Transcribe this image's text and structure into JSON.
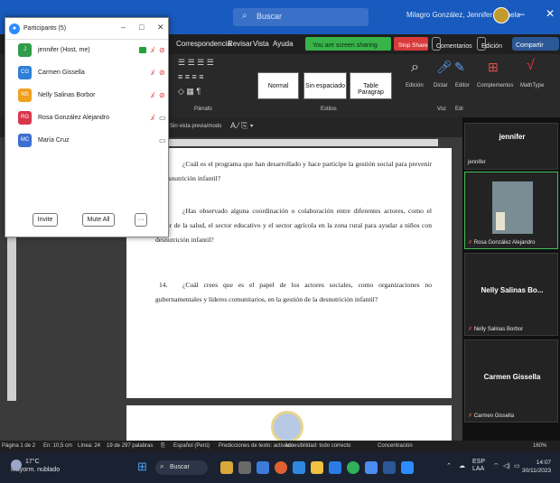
{
  "word": {
    "search_placeholder": "Buscar",
    "user_name": "Milagro González, Jennifer Leonela",
    "window_min": "–",
    "window_max": "□",
    "window_close": "✕",
    "tabs": [
      "Correspondencia",
      "Revisar",
      "Vista",
      "Ayuda"
    ],
    "sharing_label": "You are screen sharing",
    "stop_share_label": "Stop Share",
    "comments_label": "Comentarios",
    "editing_label": "Edición",
    "share_label": "Compartir",
    "styles": [
      "Normal",
      "Sin espaciado",
      "Table Paragrap"
    ],
    "ribbon_labels": {
      "paragraph": "Párrafo",
      "styles": "Estilos",
      "editing": "Edición",
      "dictate": "Dictar",
      "editor": "Editor",
      "addins": "Complementos",
      "mathtype": "MathType",
      "voice": "Voz",
      "editor2": "Edi"
    },
    "format_hint": "Sin vista previa/modo",
    "document": {
      "q12_num": "12.",
      "q12": "¿Cuál es el programa que han desarrollado y hace participe la gestión social para prevenir la desnutrición infantil?",
      "q13_num": "13.",
      "q13": "¿Has observado alguna coordinación o colaboración entre diferentes actores, como el sector de la salud, el sector educativo y el sector agrícola en la zona rural para ayudar a niños con desnutrición infantil?",
      "q14_num": "14.",
      "q14": "¿Cuál crees que es el papel de los actores sociales, como organizaciones no gubernamentales y líderes comunitarios, en la gestión de la desnutrición infantil?"
    },
    "status": {
      "page": "Página 1 de 2",
      "position": "En: 10,5 cm",
      "line": "Línea: 24",
      "words": "19 de 297 palabras",
      "language": "Español (Perú)",
      "predictions": "Predicciones de texto: activado",
      "accessibility": "Accesibilidad: todo correcto",
      "focus": "Concentración",
      "zoom": "160%"
    }
  },
  "participants": {
    "title": "Participants (5)",
    "min": "–",
    "max": "□",
    "close": "✕",
    "list": [
      {
        "initials": "J",
        "name": "jennifer (Host, me)",
        "color": "#2e9c48"
      },
      {
        "initials": "CG",
        "name": "Carmen Gissella",
        "color": "#2f7ed8"
      },
      {
        "initials": "NS",
        "name": "Nelly Salinas Borbor",
        "color": "#f0a020"
      },
      {
        "initials": "RG",
        "name": "Rosa González Alejandro",
        "color": "#d9364a"
      },
      {
        "initials": "MC",
        "name": "María Cruz",
        "color": "#3c6fd0"
      }
    ],
    "invite": "Invite",
    "mute_all": "Mute All",
    "more": "···"
  },
  "gallery": {
    "tiles": [
      {
        "big": "jennifer",
        "small": "jennifer"
      },
      {
        "big": "",
        "small": "Rosa González Alejandro"
      },
      {
        "big": "Nelly Salinas Bo...",
        "small": "Nelly Salinas Borbor"
      },
      {
        "big": "Carmen Gissella",
        "small": "Carmen Gissella"
      }
    ]
  },
  "taskbar": {
    "temp": "17°C",
    "weather": "Mayorm. nublado",
    "search": "Buscar",
    "lang": "ESP",
    "lang2": "LAA",
    "time": "14:07",
    "date": "30/11/2023"
  }
}
